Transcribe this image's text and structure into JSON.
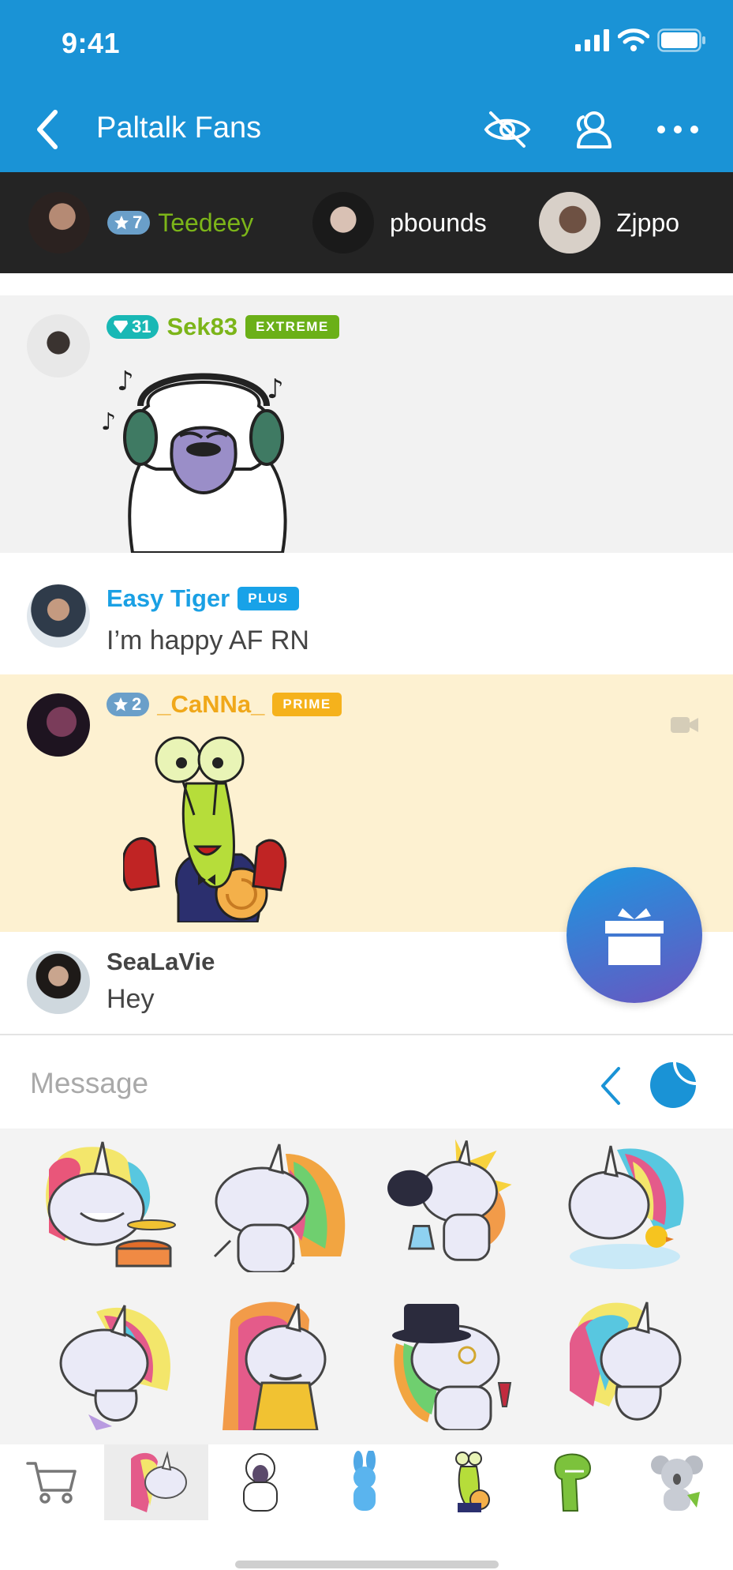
{
  "status": {
    "time": "9:41"
  },
  "nav": {
    "title": "Paltalk Fans"
  },
  "viewers": [
    {
      "name": "Teedeey",
      "rank": "7",
      "name_color": "#7cb519"
    },
    {
      "name": "pbounds"
    },
    {
      "name": "Zjppo"
    }
  ],
  "messages": [
    {
      "user": "Sek83",
      "badge_count": "31",
      "tier": "EXTREME",
      "tier_color": "#6bb018",
      "name_color": "#7cb519",
      "sticker": "sheep-headphones-sticker"
    },
    {
      "user": "Easy Tiger",
      "tier": "PLUS",
      "tier_color": "#18a2e8",
      "name_color": "#1aa0e4",
      "text": "I’m happy AF RN"
    },
    {
      "user": "_CaNNa_",
      "badge_count": "2",
      "tier": "PRIME",
      "tier_color": "#f5b21c",
      "name_color": "#f0a81a",
      "sticker": "snail-thumbs-up-sticker"
    },
    {
      "user": "SeaLaVie",
      "name_color": "#444444",
      "text": "Hey"
    }
  ],
  "composer": {
    "placeholder": "Message"
  },
  "stickers": [
    "unicorn-drummer-sticker",
    "unicorn-shrug-sticker",
    "unicorn-scientist-sticker",
    "unicorn-bath-sticker",
    "unicorn-mischief-sticker",
    "unicorn-disguise-sticker",
    "unicorn-gentleman-sticker",
    "unicorn-nervous-sticker"
  ],
  "packs": [
    "cart-icon",
    "unicorn-pack",
    "sheep-pack",
    "rabbit-pack",
    "snail-pack",
    "dinosaur-pack",
    "koala-pack"
  ],
  "colors": {
    "brand": "#1a93d6",
    "highlight_row": "#fdf1d1",
    "alt_row": "#f2f2f2"
  }
}
